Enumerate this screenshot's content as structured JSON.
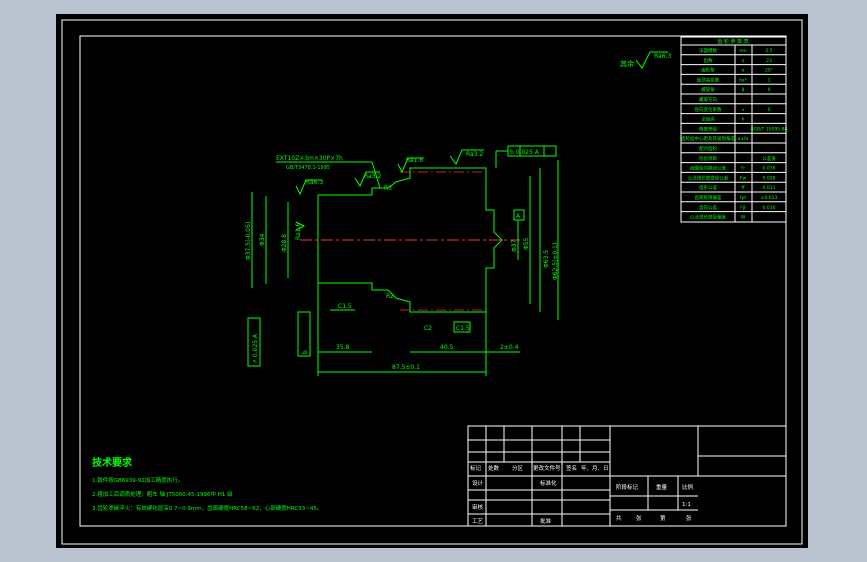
{
  "roughness_global": "Ra6.3",
  "roughness_global_label": "其余",
  "params_title": "齿 轮 参 数 表",
  "params": [
    {
      "name": "法面模数",
      "sym": "mn",
      "val": "2.5"
    },
    {
      "name": "齿数",
      "sym": "z",
      "val": "23"
    },
    {
      "name": "齿形角",
      "sym": "α",
      "val": "20°"
    },
    {
      "name": "齿顶高系数",
      "sym": "ha*",
      "val": "1"
    },
    {
      "name": "螺旋角",
      "sym": "β",
      "val": "0"
    },
    {
      "name": "螺旋方向",
      "sym": "",
      "val": ""
    },
    {
      "name": "径向变位系数",
      "sym": "x",
      "val": "0"
    },
    {
      "name": "全齿高",
      "sym": "h",
      "val": ""
    },
    {
      "name": "精度等级",
      "sym": "",
      "val": "8GB/T 10095-88"
    },
    {
      "name": "齿轮副中心距及其极限偏差",
      "sym": "a±fa",
      "val": ""
    },
    {
      "name": "配对齿轮",
      "sym": "",
      "val": ""
    },
    {
      "name": "检验项目",
      "sym": "",
      "val": "公差值"
    },
    {
      "name": "齿圈径向跳动公差",
      "sym": "Fr",
      "val": "0.036"
    },
    {
      "name": "公法线长度变动公差",
      "sym": "Fw",
      "val": "0.028"
    },
    {
      "name": "齿形公差",
      "sym": "ff",
      "val": "0.011"
    },
    {
      "name": "齿距极限偏差",
      "sym": "fpt",
      "val": "±0.013"
    },
    {
      "name": "齿向公差",
      "sym": "Fβ",
      "val": "0.010"
    },
    {
      "name": "公法线长度及偏差",
      "sym": "W",
      "val": ""
    }
  ],
  "callouts": {
    "spline": "EXT10Z×3m×30P×7h",
    "spline_std": "GB/T3478.1-1995",
    "ra_a": "Ra6.3",
    "ra_b": "Ra1.6",
    "ra_c": "Ra3.2",
    "ra_d": "Ra3.2",
    "ra_e": "Ra1.6",
    "tol_right": "b  0.025  A",
    "tol_left": "↗  0.025  A",
    "datum_b": "b",
    "datum_a": "A",
    "cham1": "C1.5",
    "cham2": "C2",
    "cham3": "C1.5",
    "r1": "R3",
    "r2": "R2"
  },
  "dims": {
    "d_left_outer": "Φ37.5(-0.05)",
    "d_left_2": "Φ34",
    "d_left_3": "Φ28.8",
    "d_root": "Φ55",
    "d_bore": "Φ37",
    "d_right": "Φ63.5",
    "d_tip": "Φ62.5(±0.1)",
    "len_left": "35.8",
    "len_right": "40.5",
    "len_small": "2±0.4",
    "len_total": "87.5±0.1"
  },
  "tech_title": "技术要求",
  "tech_lines": [
    "1.锻件按GB6939-92加工精度执行。",
    "2.粗加工后调质处理，粗车 轴 JT5000.45-1996中 H1 级",
    "3.齿轮渗碳淬火：有效硬化层深0.7~0.9mm，齿面硬度HRC58~62，心部硬度HRC33~45。"
  ],
  "title_block": {
    "row_labels": [
      "标记",
      "处数",
      "分区",
      "更改文件号",
      "签名",
      "年、月、日"
    ],
    "design": "设计",
    "standard": "标准化",
    "stage": "阶段标记",
    "weight": "重量",
    "scale": "比例",
    "scale_val": "1:1",
    "check": "审核",
    "craft": "工艺",
    "approve": "批准",
    "sheets": [
      "共",
      "张",
      "第",
      "张"
    ]
  }
}
